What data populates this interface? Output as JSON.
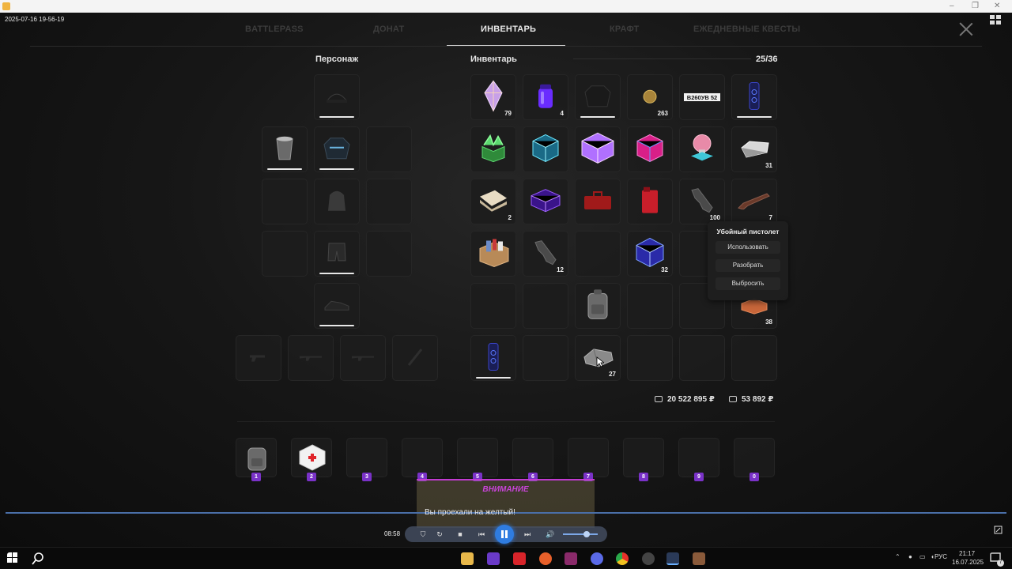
{
  "window": {
    "controls": [
      "–",
      "❐",
      "✕"
    ]
  },
  "overlay": {
    "timestamp": "2025-07-16 19-56-19"
  },
  "tabs": [
    {
      "label": "BATTLEPASS",
      "active": false
    },
    {
      "label": "ДОНАТ",
      "active": false
    },
    {
      "label": "ИНВЕНТАРЬ",
      "active": true
    },
    {
      "label": "КРАФТ",
      "active": false
    },
    {
      "label": "ЕЖЕДНЕВНЫЕ КВЕСТЫ",
      "active": false
    }
  ],
  "character": {
    "title": "Персонаж"
  },
  "inventory": {
    "title": "Инвентарь",
    "capacity": "25/36",
    "counts": {
      "crystal": "79",
      "jar": "4",
      "coin": "263",
      "ingot": "31",
      "fabric": "2",
      "pistol": "100",
      "rifle": "7",
      "toolbox_pistol": "12",
      "cube": "32",
      "bricks": "38",
      "stone": "27"
    },
    "plate_text": "B260УВ 52"
  },
  "context_menu": {
    "title": "Убойный пистолет",
    "use": "Использовать",
    "disassemble": "Разобрать",
    "drop": "Выбросить"
  },
  "balance": {
    "cash": "20 522 895 ₽",
    "bank": "53 892 ₽"
  },
  "hotbar": [
    "1",
    "2",
    "3",
    "4",
    "5",
    "6",
    "7",
    "8",
    "9",
    "0"
  ],
  "notice": {
    "title": "ВНИМАНИЕ",
    "text": "Вы проехали на желтый!"
  },
  "player": {
    "time": "08:58"
  },
  "taskbar": {
    "lang": "РУС",
    "time": "21:17",
    "date": "16.07.2025",
    "badge": "7"
  },
  "colors": {
    "accent": "#7a32c8",
    "player": "#2f7ce0",
    "notice": "#c844d8"
  }
}
